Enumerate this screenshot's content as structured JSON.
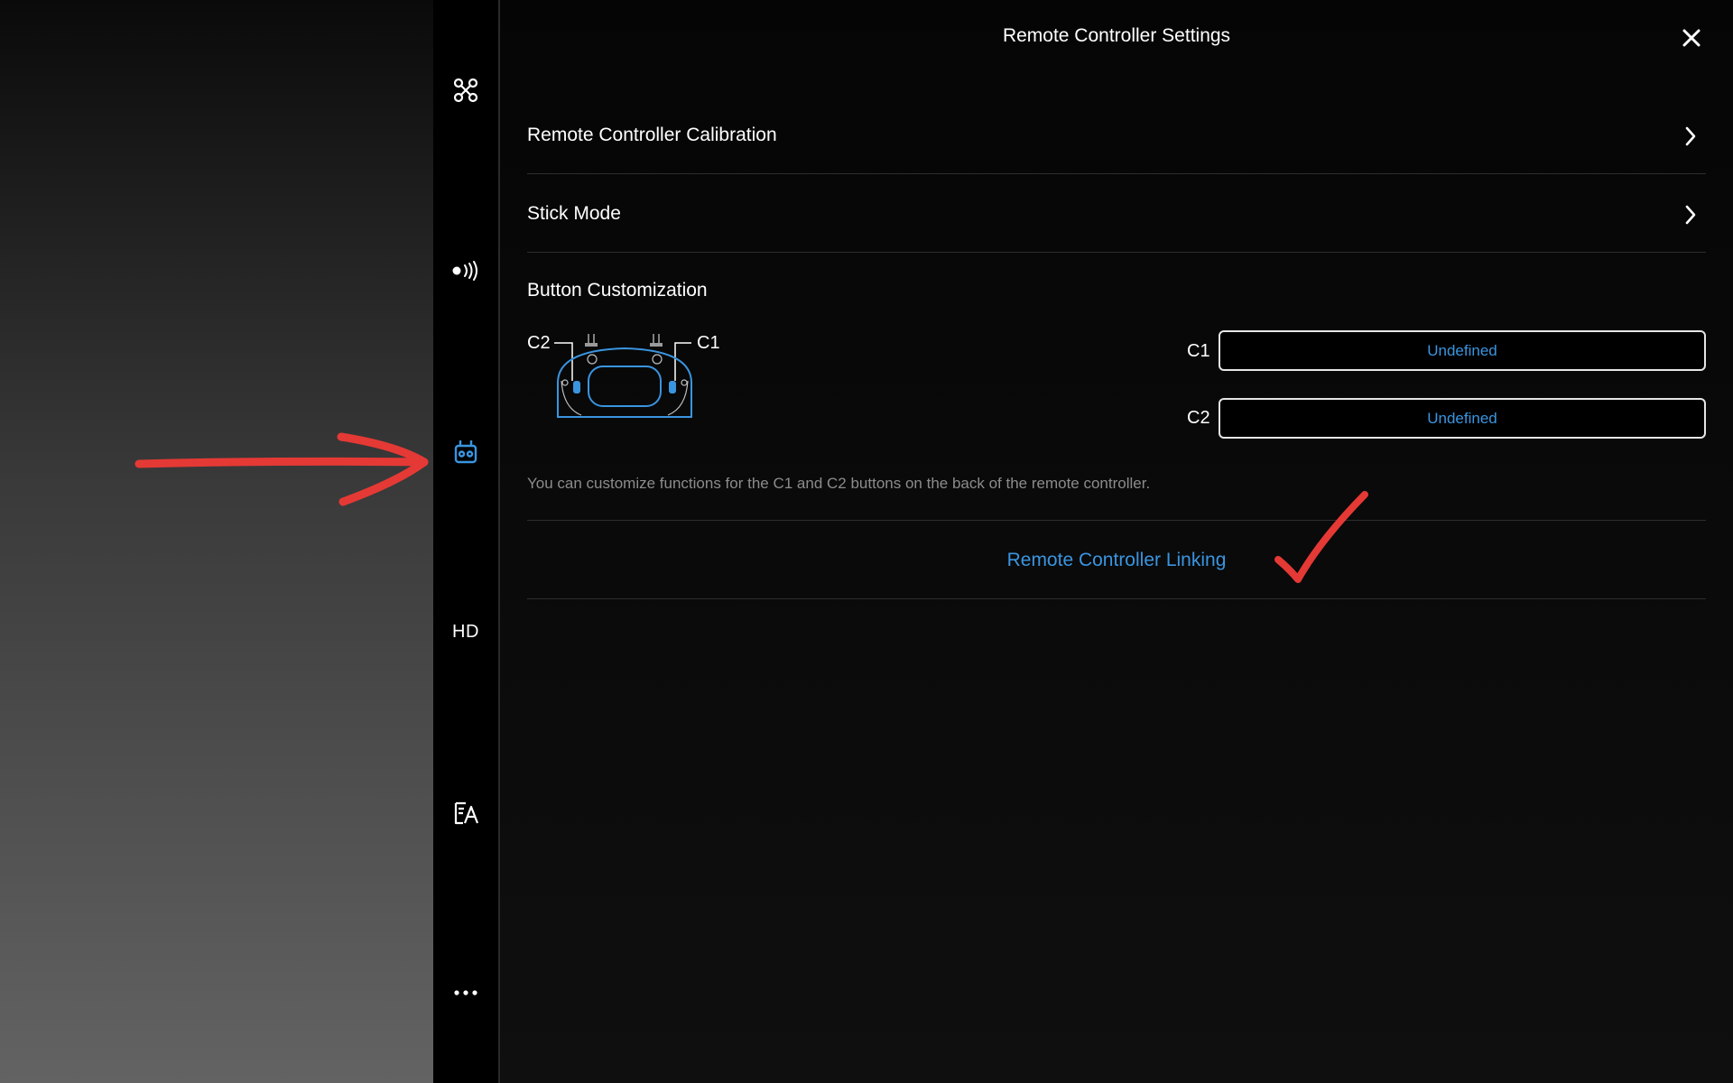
{
  "header": {
    "title": "Remote Controller Settings"
  },
  "sidebar": {
    "items": [
      {
        "name": "aircraft",
        "icon": "drone-icon"
      },
      {
        "name": "control",
        "icon": "signal-icon"
      },
      {
        "name": "remote-controller",
        "icon": "remote-controller-icon",
        "active": true
      },
      {
        "name": "transmission",
        "icon": "hd-icon",
        "label": "HD"
      },
      {
        "name": "safety",
        "icon": "checklist-icon"
      },
      {
        "name": "more",
        "icon": "more-icon"
      }
    ]
  },
  "settings": {
    "calibration_label": "Remote Controller Calibration",
    "stick_mode_label": "Stick Mode",
    "button_customization_label": "Button Customization",
    "diagram": {
      "c2_label": "C2",
      "c1_label": "C1"
    },
    "c1": {
      "label": "C1",
      "value": "Undefined"
    },
    "c2": {
      "label": "C2",
      "value": "Undefined"
    },
    "hint": "You can customize functions for the C1 and C2 buttons on the back of the remote controller.",
    "linking_label": "Remote Controller Linking"
  },
  "colors": {
    "accent": "#3a95e0",
    "annotation": "#e53935",
    "background": "#0a0a0a",
    "divider": "#2e2e2e"
  }
}
